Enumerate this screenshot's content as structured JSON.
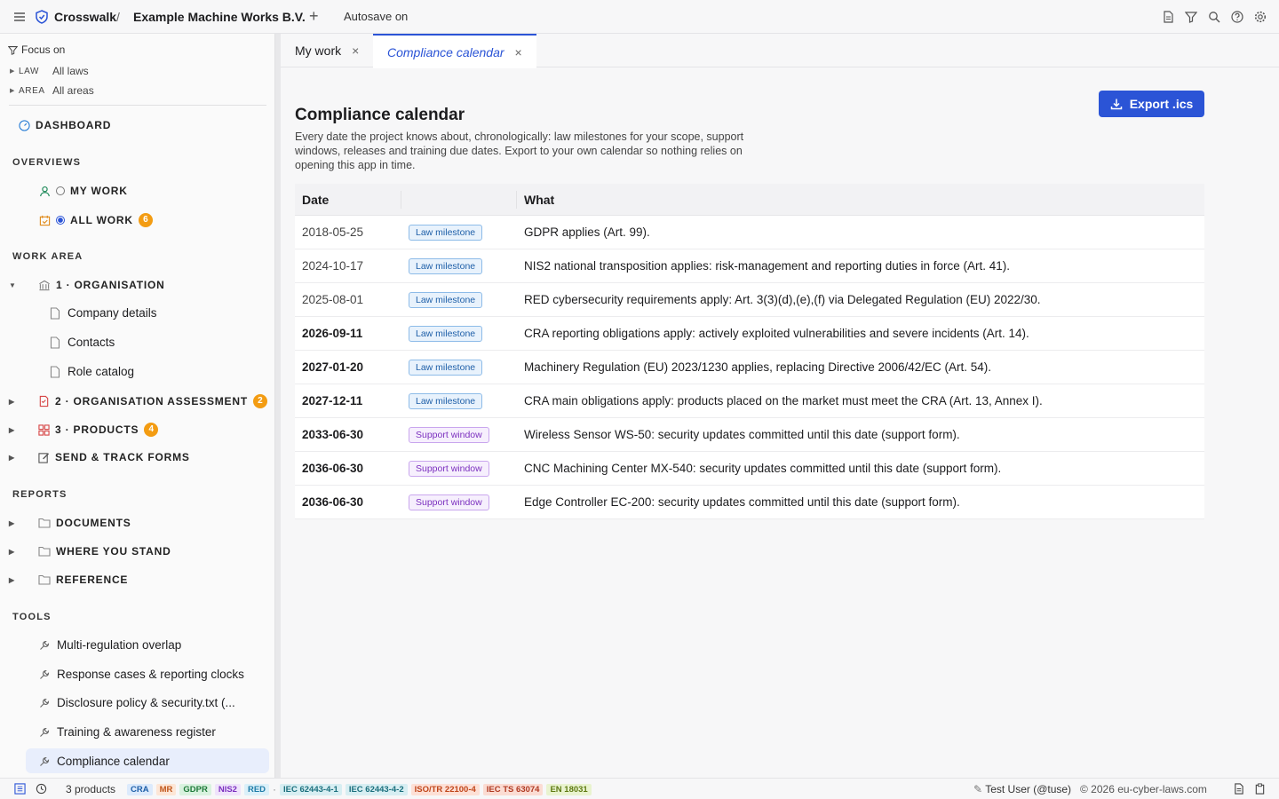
{
  "topbar": {
    "brand": "Crosswalk",
    "separator": "/",
    "project": "Example Machine Works B.V.",
    "autosave": "Autosave on"
  },
  "sidebar": {
    "focus_label": "Focus on",
    "filters": [
      {
        "key": "LAW",
        "value": "All laws"
      },
      {
        "key": "AREA",
        "value": "All areas"
      }
    ],
    "dashboard": "DASHBOARD",
    "overviews_title": "OVERVIEWS",
    "my_work": "MY WORK",
    "all_work": "ALL WORK",
    "all_work_count": "6",
    "work_area_title": "WORK AREA",
    "org": "1 · ORGANISATION",
    "org_children": [
      "Company details",
      "Contacts",
      "Role catalog"
    ],
    "org_assessment": "2 · ORGANISATION ASSESSMENT",
    "org_assessment_count": "2",
    "products": "3 · PRODUCTS",
    "products_count": "4",
    "forms": "SEND & TRACK FORMS",
    "reports_title": "REPORTS",
    "documents": "DOCUMENTS",
    "where_you_stand": "WHERE YOU STAND",
    "reference": "REFERENCE",
    "tools_title": "TOOLS",
    "tools": [
      "Multi-regulation overlap",
      "Response cases & reporting clocks",
      "Disclosure policy & security.txt (...",
      "Training & awareness register",
      "Compliance calendar"
    ]
  },
  "tabs": [
    {
      "label": "My work",
      "close": "×"
    },
    {
      "label": "Compliance calendar",
      "close": "×"
    }
  ],
  "main": {
    "title": "Compliance calendar",
    "description": "Every date the project knows about, chronologically: law milestones for your scope, support windows, releases and training due dates. Export to your own calendar so nothing relies on opening this app in time.",
    "export_label": "Export .ics",
    "columns": [
      "Date",
      "",
      "What"
    ],
    "rows": [
      {
        "date": "2018-05-25",
        "type": "Law milestone",
        "kind": "law",
        "future": false,
        "what": "GDPR applies (Art. 99)."
      },
      {
        "date": "2024-10-17",
        "type": "Law milestone",
        "kind": "law",
        "future": false,
        "what": "NIS2 national transposition applies: risk-management and reporting duties in force (Art. 41)."
      },
      {
        "date": "2025-08-01",
        "type": "Law milestone",
        "kind": "law",
        "future": false,
        "what": "RED cybersecurity requirements apply: Art. 3(3)(d),(e),(f) via Delegated Regulation (EU) 2022/30."
      },
      {
        "date": "2026-09-11",
        "type": "Law milestone",
        "kind": "law",
        "future": true,
        "what": "CRA reporting obligations apply: actively exploited vulnerabilities and severe incidents (Art. 14)."
      },
      {
        "date": "2027-01-20",
        "type": "Law milestone",
        "kind": "law",
        "future": true,
        "what": "Machinery Regulation (EU) 2023/1230 applies, replacing Directive 2006/42/EC (Art. 54)."
      },
      {
        "date": "2027-12-11",
        "type": "Law milestone",
        "kind": "law",
        "future": true,
        "what": "CRA main obligations apply: products placed on the market must meet the CRA (Art. 13, Annex I)."
      },
      {
        "date": "2033-06-30",
        "type": "Support window",
        "kind": "support",
        "future": true,
        "what": "Wireless Sensor WS-50: security updates committed until this date (support form)."
      },
      {
        "date": "2036-06-30",
        "type": "Support window",
        "kind": "support",
        "future": true,
        "what": "CNC Machining Center MX-540: security updates committed until this date (support form)."
      },
      {
        "date": "2036-06-30",
        "type": "Support window",
        "kind": "support",
        "future": true,
        "what": "Edge Controller EC-200: security updates committed until this date (support form)."
      }
    ]
  },
  "statusbar": {
    "products": "3 products",
    "separator": "·",
    "laws": [
      {
        "label": "CRA",
        "fg": "#1e5fa8",
        "bg": "#dceafc"
      },
      {
        "label": "MR",
        "fg": "#c0561a",
        "bg": "#fde6d6"
      },
      {
        "label": "GDPR",
        "fg": "#1f7a3a",
        "bg": "#d9f2df"
      },
      {
        "label": "NIS2",
        "fg": "#7b2fbf",
        "bg": "#efe3fb"
      },
      {
        "label": "RED",
        "fg": "#1e7ca8",
        "bg": "#dbf0f9"
      }
    ],
    "standards": [
      {
        "label": "IEC 62443-4-1",
        "fg": "#1a6f7d",
        "bg": "#d7eef2"
      },
      {
        "label": "IEC 62443-4-2",
        "fg": "#1a6f7d",
        "bg": "#d7eef2"
      },
      {
        "label": "ISO/TR 22100-4",
        "fg": "#c0461a",
        "bg": "#fde0d6"
      },
      {
        "label": "IEC TS 63074",
        "fg": "#b03a22",
        "bg": "#fbdcd3"
      },
      {
        "label": "EN 18031",
        "fg": "#5e7a12",
        "bg": "#e9f3cf"
      }
    ],
    "user": "Test User (@tuse)",
    "copyright": "© 2026 eu-cyber-laws.com"
  }
}
